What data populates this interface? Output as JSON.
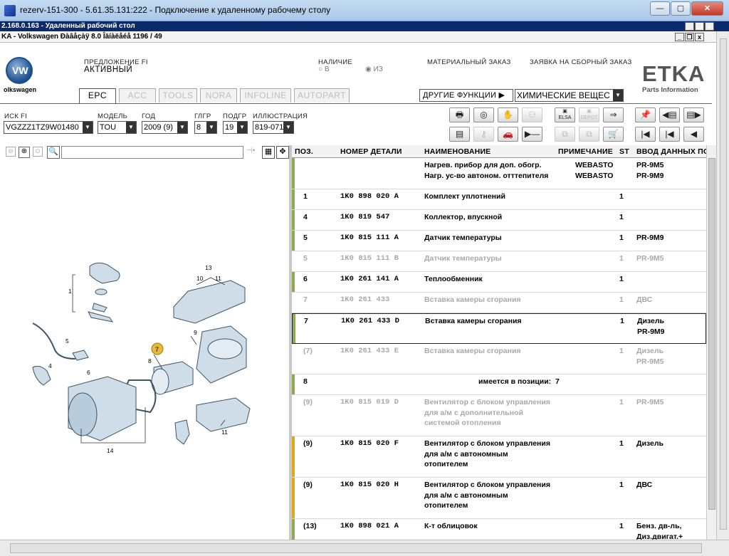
{
  "window": {
    "title": "rezerv-151-300 - 5.61.35.131:222 - Подключение к удаленному рабочему столу",
    "min_label": "—",
    "max_label": "▢",
    "close_label": "✕"
  },
  "rdp_bar": {
    "title": "2.168.0.163 - Удаленный рабочий стол"
  },
  "app_bar": {
    "title": "KA - Volkswagen Ðàâåçàÿ 8.0 Îäíàëåéå 1196 / 49"
  },
  "brand": {
    "logo_text": "VW",
    "brand_name": "olkswagen",
    "etka": "ETKA",
    "etka_sub": "Parts Information"
  },
  "offer": {
    "label": "ПРЕДЛОЖЕНИЕ FI",
    "value": "АКТИВНЫЙ"
  },
  "availability": {
    "label": "НАЛИЧИЕ",
    "opt1": "В",
    "opt2": "ИЗ"
  },
  "links": {
    "material_order": "МАТЕРИАЛЬНЫЙ ЗАКАЗ",
    "assembly_order": "ЗАЯВКА НА СБОРНЫЙ ЗАКАЗ"
  },
  "tabs": [
    "EPC",
    "ACC",
    "TOOLS",
    "NORA",
    "INFOLINE",
    "AUTOPART"
  ],
  "other_functions": "ДРУГИЕ ФУНКЦИИ ▶",
  "chemicals": "ХИМИЧЕСКИЕ ВЕЩЕС",
  "fields": {
    "vin_label": "ИСК FI",
    "vin_value": "VGZZZ1TZ9W01480",
    "model_label": "МОДЕЛЬ",
    "model_value": "TOU",
    "year_label": "ГОД",
    "year_value": "2009 (9)",
    "mg_label": "ГЛГР",
    "mg_value": "8",
    "sg_label": "ПОДГР",
    "sg_value": "19",
    "ill_label": "ИЛЛЮСТРАЦИЯ",
    "ill_value": "819-071"
  },
  "grid": {
    "headers": [
      "ПОЗ.",
      "НОМЕР ДЕТАЛИ",
      "НАИМЕНОВАНИЕ",
      "ПРИМЕЧАНИЕ",
      "ST",
      "ВВОД ДАННЫХ ПО"
    ],
    "rows": [
      {
        "pos": "",
        "part": "",
        "name": "Нагрев. прибор для доп. обогр.\nНагр. ус-во автоном. отттепителя",
        "note": "WEBASTO\nWEBASTO",
        "st": "",
        "input": "PR-9M5\nPR-9M9",
        "style": "normal",
        "bar": "green"
      },
      {
        "pos": "1",
        "part": "1K0 898 020 A",
        "name": "Комплект уплотнений",
        "note": "",
        "st": "1",
        "input": "",
        "style": "normal",
        "bar": "green"
      },
      {
        "pos": "4",
        "part": "1K0 819 547",
        "name": "Коллектор, впускной",
        "note": "",
        "st": "1",
        "input": "",
        "style": "normal",
        "bar": "green"
      },
      {
        "pos": "5",
        "part": "1K0 815 111 A",
        "name": "Датчик температуры",
        "note": "",
        "st": "1",
        "input": "PR-9M9",
        "style": "normal",
        "bar": "green"
      },
      {
        "pos": "5",
        "part": "1K0 815 111 B",
        "name": "Датчик температуры",
        "note": "",
        "st": "1",
        "input": "PR-9M5",
        "style": "gray",
        "bar": "none"
      },
      {
        "pos": "6",
        "part": "1K0 261 141 A",
        "name": "Теплообменник",
        "note": "",
        "st": "1",
        "input": "",
        "style": "normal",
        "bar": "green"
      },
      {
        "pos": "7",
        "part": "1K0 261 433",
        "name": "Вставка камеры сгорания",
        "note": "",
        "st": "1",
        "input": "ДВС",
        "style": "gray",
        "bar": "none"
      },
      {
        "pos": "7",
        "part": "1K0 261 433 D",
        "name": "Вставка камеры сгорания",
        "note": "",
        "st": "1",
        "input": "Дизель\nPR-9M9",
        "style": "sel",
        "bar": "green"
      },
      {
        "pos": "(7)",
        "part": "1K0 261 433 E",
        "name": "Вставка камеры сгорания",
        "note": "",
        "st": "1",
        "input": "Дизель\nPR-9M5",
        "style": "gray",
        "bar": "none"
      },
      {
        "pos": "8",
        "part": "",
        "name": "имеется в позиции:  7",
        "note": "",
        "st": "",
        "input": "",
        "style": "center",
        "bar": "green"
      },
      {
        "pos": "(9)",
        "part": "1K0 815 019 D",
        "name": "Вентилятор с блоком управления\nдля а/м с дополнительной\nсистемой отопления",
        "note": "",
        "st": "1",
        "input": "PR-9M5",
        "style": "gray",
        "bar": "none"
      },
      {
        "pos": "(9)",
        "part": "1K0 815 020 F",
        "name": "Вентилятор с блоком управления\nдля а/м с автономным\nотопителем",
        "note": "",
        "st": "1",
        "input": "Дизель",
        "style": "normal",
        "bar": "yellow"
      },
      {
        "pos": "(9)",
        "part": "1K0 815 020 H",
        "name": "Вентилятор с блоком управления\nдля а/м с автономным\nотопителем",
        "note": "",
        "st": "1",
        "input": "ДВС",
        "style": "normal",
        "bar": "yellow"
      },
      {
        "pos": "(13)",
        "part": "1K0 898 021 A",
        "name": "К-т облицовок",
        "note": "",
        "st": "1",
        "input": "Бенз. дв-ль,\nДиз.двигат.+",
        "style": "normal",
        "bar": "green"
      }
    ]
  },
  "diagram": {
    "callouts": [
      "1",
      "4",
      "5",
      "6",
      "7",
      "8",
      "9",
      "10",
      "11",
      "13",
      "14"
    ],
    "highlight": "7"
  }
}
